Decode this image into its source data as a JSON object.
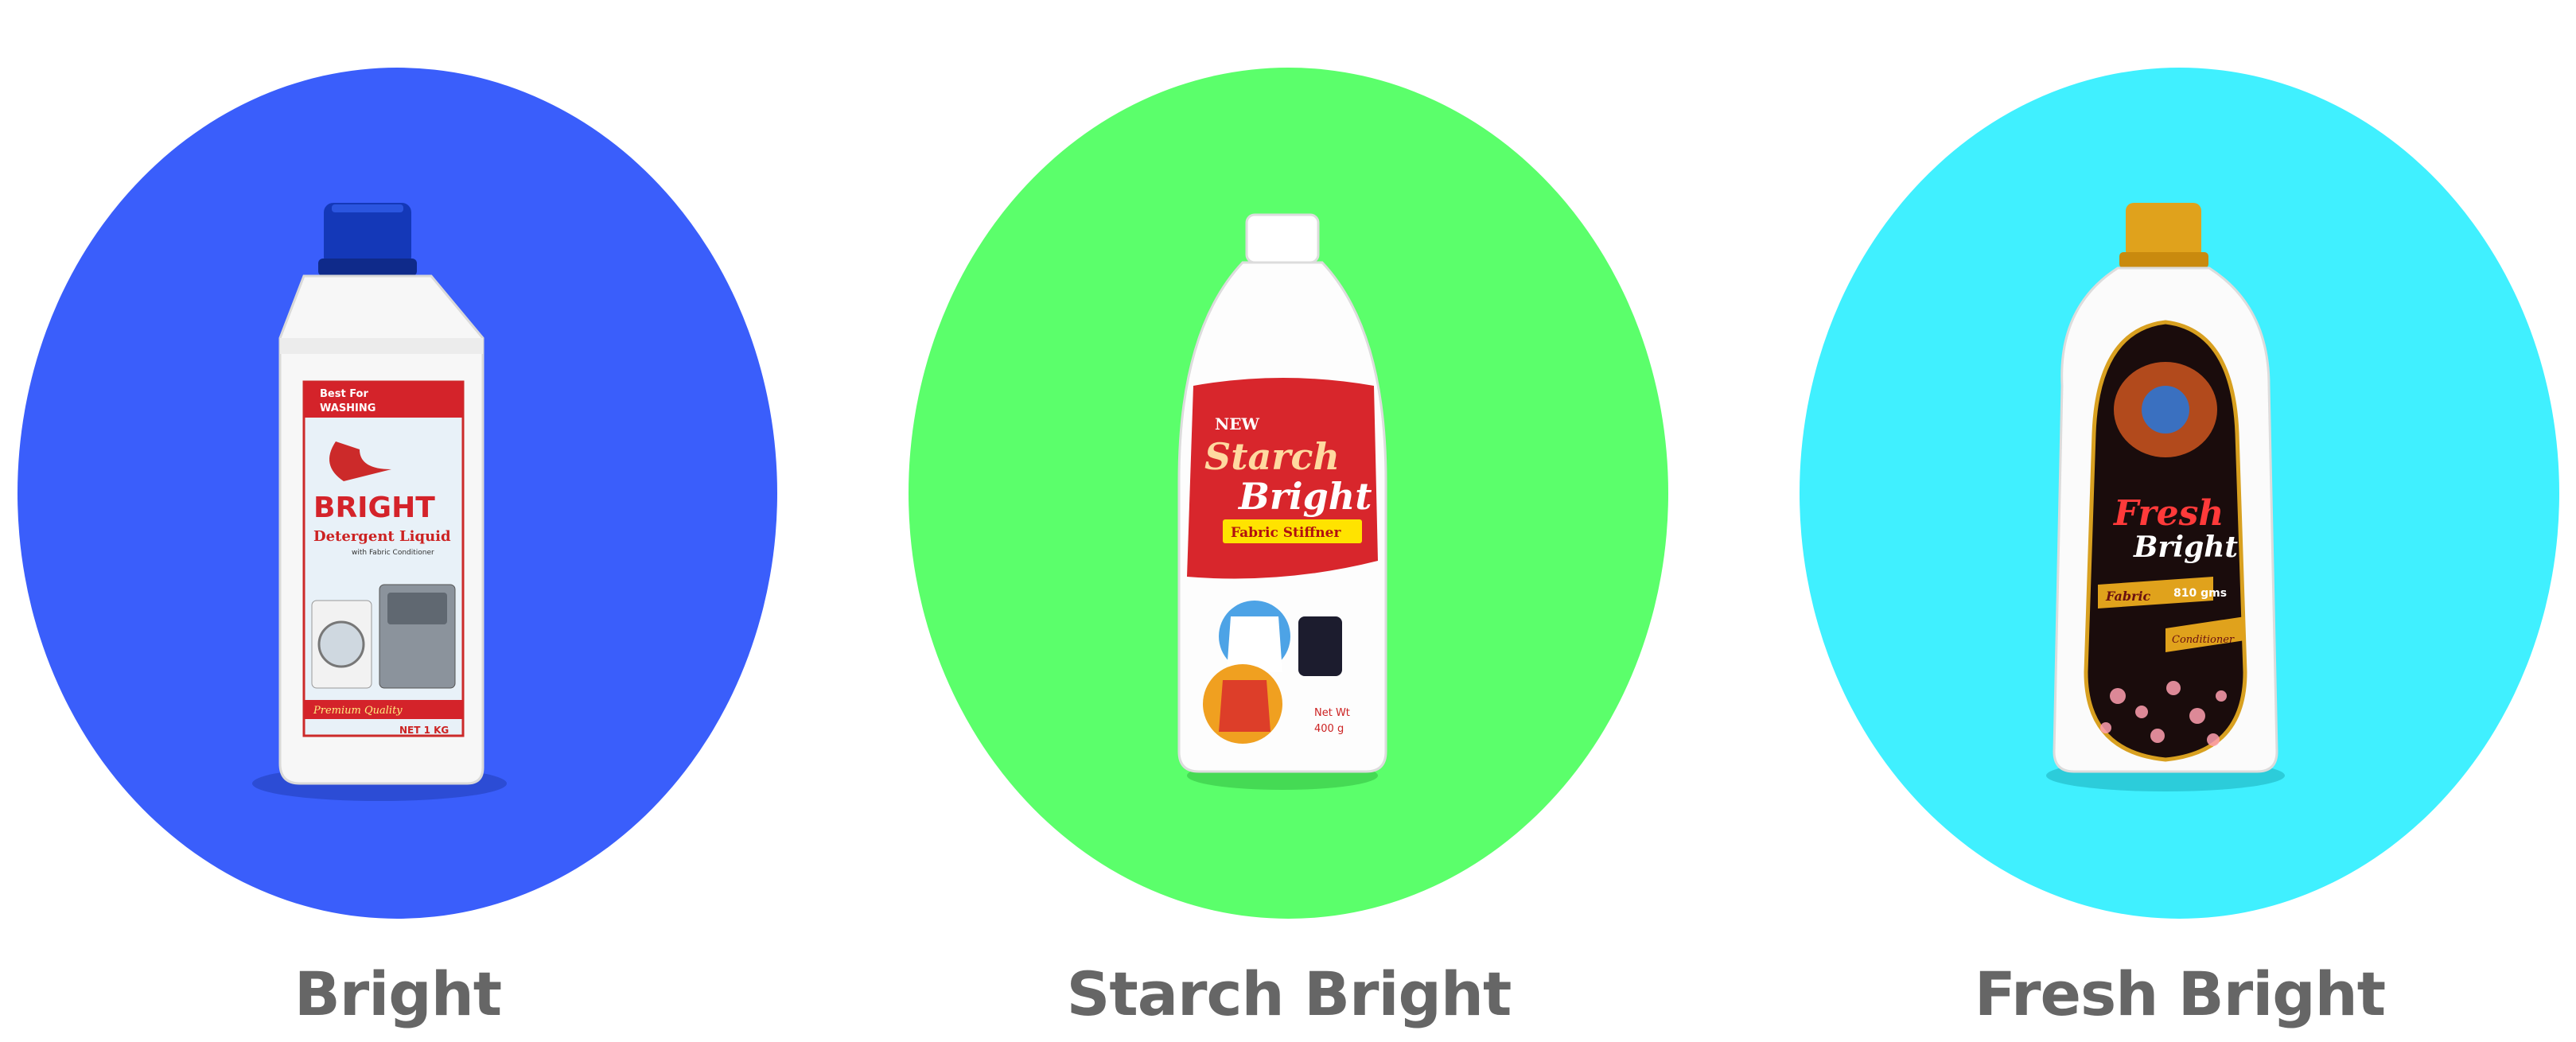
{
  "products": [
    {
      "name": "Bright",
      "bg_color": "#3a5efb",
      "label": {
        "top_line1": "Best For",
        "top_line2": "WASHING",
        "brand": "BRIGHT",
        "subtitle": "Detergent Liquid",
        "small": "with Fabric Conditioner",
        "quality": "Premium Quality",
        "net": "NET 1 KG"
      }
    },
    {
      "name": "Starch Bright",
      "bg_color": "#5bff6b",
      "label": {
        "new": "NEW",
        "brand1": "Starch",
        "brand2": "Bright",
        "tag": "Fabric Stiffner",
        "net1": "Net Wt",
        "net2": "400 g"
      }
    },
    {
      "name": "Fresh Bright",
      "bg_color": "#40f0ff",
      "label": {
        "brand1": "Fresh",
        "brand2": "Bright",
        "tag1": "Fabric",
        "tag2": "Conditioner",
        "net": "810 gms"
      }
    }
  ]
}
